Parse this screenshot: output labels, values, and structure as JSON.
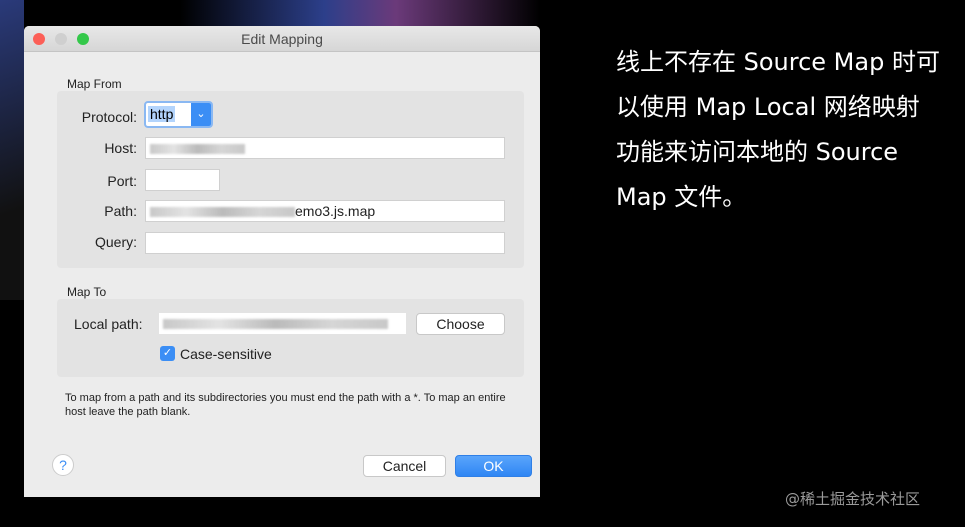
{
  "window": {
    "title": "Edit Mapping"
  },
  "map_from": {
    "label": "Map From",
    "protocol_label": "Protocol:",
    "protocol_value": "http",
    "host_label": "Host:",
    "port_label": "Port:",
    "path_label": "Path:",
    "path_value_visible": "emo3.js.map",
    "query_label": "Query:"
  },
  "map_to": {
    "label": "Map To",
    "local_path_label": "Local path:",
    "choose_label": "Choose",
    "case_sensitive_label": "Case-sensitive",
    "case_sensitive_checked": true
  },
  "help_text": "To map from a path and its subdirectories you must end the path with a *. To map an entire host leave the path blank.",
  "buttons": {
    "help": "?",
    "cancel": "Cancel",
    "ok": "OK"
  },
  "caption": {
    "lines": [
      "线上不存在 Source Map 时可",
      "以使用 Map Local 网络映射",
      "功能来访问本地的 Source",
      "Map 文件。"
    ]
  },
  "watermark": "@稀土掘金技术社区",
  "colors": {
    "accent": "#3b8ef5"
  }
}
